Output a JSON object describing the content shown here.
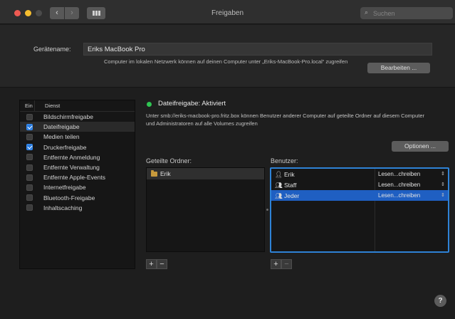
{
  "window": {
    "title": "Freigaben",
    "search_placeholder": "Suchen"
  },
  "device": {
    "label": "Gerätename:",
    "name": "Eriks MacBook Pro",
    "description": "Computer im lokalen Netzwerk können auf deinen Computer unter „Eriks-MacBook-Pro.local“ zugreifen",
    "edit_label": "Bearbeiten ..."
  },
  "services": {
    "header_on": "Ein",
    "header_service": "Dienst",
    "items": [
      {
        "label": "Bildschirmfreigabe",
        "checked": false
      },
      {
        "label": "Dateifreigabe",
        "checked": true,
        "selected": true
      },
      {
        "label": "Medien teilen",
        "checked": false
      },
      {
        "label": "Druckerfreigabe",
        "checked": true
      },
      {
        "label": "Entfernte Anmeldung",
        "checked": false
      },
      {
        "label": "Entfernte Verwaltung",
        "checked": false
      },
      {
        "label": "Entfernte Apple-Events",
        "checked": false
      },
      {
        "label": "Internetfreigabe",
        "checked": false
      },
      {
        "label": "Bluetooth-Freigabe",
        "checked": false
      },
      {
        "label": "Inhaltscaching",
        "checked": false
      }
    ]
  },
  "status": {
    "text": "Dateifreigabe: Aktiviert",
    "color": "#2fc552",
    "description": "Unter smb://eriks-macbook-pro.fritz.box können Benutzer anderer Computer auf geteilte Ordner auf diesem Computer und Administratoren auf alle Volumes zugreifen",
    "options_label": "Optionen ..."
  },
  "folders": {
    "label": "Geteilte Ordner:",
    "items": [
      {
        "name": "Erik",
        "icon": "folder-icon"
      }
    ]
  },
  "users": {
    "label": "Benutzer:",
    "items": [
      {
        "name": "Erik",
        "icon": "person-icon",
        "permission": "Lesen...chreiben"
      },
      {
        "name": "Staff",
        "icon": "group-icon",
        "permission": "Lesen...chreiben"
      },
      {
        "name": "Jeder",
        "icon": "everyone-icon",
        "permission": "Lesen...chreiben",
        "selected": true
      }
    ]
  },
  "buttons": {
    "plus": "+",
    "minus": "−",
    "help": "?"
  },
  "colors": {
    "accent": "#2e82d6",
    "selection": "#1f5fc2"
  }
}
